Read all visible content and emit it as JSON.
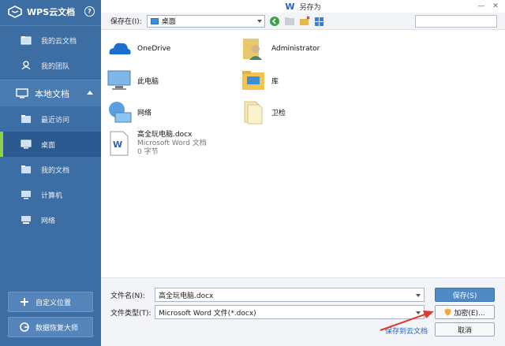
{
  "sidebar": {
    "brand": "WPS云文档",
    "help": "?",
    "cloud_items": [
      {
        "label": "我的云文档",
        "icon": "cloud-folder-icon"
      },
      {
        "label": "我的团队",
        "icon": "team-icon"
      }
    ],
    "local_section": {
      "label": "本地文档",
      "icon": "monitor-icon"
    },
    "local_items": [
      {
        "label": "最近访问",
        "icon": "recent-folder-icon"
      },
      {
        "label": "桌面",
        "icon": "desktop-icon"
      },
      {
        "label": "我的文档",
        "icon": "documents-folder-icon"
      },
      {
        "label": "计算机",
        "icon": "computer-icon"
      },
      {
        "label": "网络",
        "icon": "network-icon"
      }
    ],
    "add_location": "自定义位置",
    "recovery": "数据恢复大师"
  },
  "dialog": {
    "title": "另存为",
    "save_in_label": "保存在(I):",
    "save_in_value": "桌面",
    "files": [
      {
        "name": "OneDrive",
        "icon": "onedrive-cloud-icon"
      },
      {
        "name": "Administrator",
        "icon": "user-folder-icon"
      },
      {
        "name": "此电脑",
        "icon": "pc-icon"
      },
      {
        "name": "库",
        "icon": "library-folder-icon"
      },
      {
        "name": "网络",
        "icon": "network-globe-icon"
      },
      {
        "name": "卫检",
        "icon": "folder-icon"
      },
      {
        "name": "高全玩电脑.docx",
        "type": "Microsoft Word 文档",
        "size": "0 字节",
        "icon": "word-doc-icon"
      }
    ],
    "filename_label": "文件名(N):",
    "filename_value": "高全玩电脑.docx",
    "filetype_label": "文件类型(T):",
    "filetype_value": "Microsoft Word 文件(*.docx)",
    "save_button": "保存(S)",
    "encrypt_button": "加密(E)...",
    "cancel_button": "取消",
    "cloud_save_link": "保存到云文档"
  },
  "colors": {
    "sidebar": "#3d6ea3",
    "accent": "#8fd14f",
    "primary": "#4f89c8"
  }
}
